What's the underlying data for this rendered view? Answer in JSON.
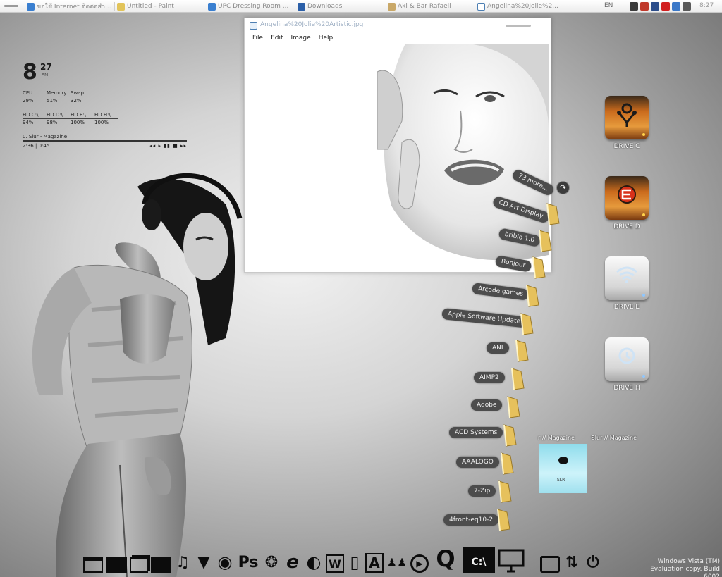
{
  "taskbar": {
    "tasks": [
      {
        "label": "ขอใช้ Internet ติดต่อสำ...",
        "icon": "ie-icon"
      },
      {
        "label": "Untitled - Paint",
        "icon": "paint-icon"
      },
      {
        "label": "UPC Dressing Room ...",
        "icon": "ie-icon"
      },
      {
        "label": "Downloads",
        "icon": "folder-icon"
      },
      {
        "label": "Aki & Bar Rafaeli",
        "icon": "folder-icon"
      },
      {
        "label": "Angelina%20Jolie%2...",
        "icon": "viewer-icon"
      }
    ],
    "language": "EN",
    "time": "8:27"
  },
  "widget": {
    "clock": {
      "hour": "8",
      "minute": "27",
      "ampm": "AM"
    },
    "stats_row1": [
      {
        "key": "CPU",
        "value": "29%"
      },
      {
        "key": "Memory",
        "value": "51%"
      },
      {
        "key": "Swap",
        "value": "32%"
      }
    ],
    "stats_row2": [
      {
        "key": "HD C:\\",
        "value": "94%"
      },
      {
        "key": "HD D:\\",
        "value": "98%"
      },
      {
        "key": "HD E:\\",
        "value": "100%"
      },
      {
        "key": "HD H:\\",
        "value": "100%"
      }
    ],
    "player": {
      "track": "0. Slur - Magazine",
      "elapsed": "2:36",
      "separator": "|",
      "total": "0:45",
      "controls": "◂◂ ▸ ▮▮ ■ ▸▸"
    }
  },
  "viewer": {
    "title": "Angelina%20Jolie%20Artistic.jpg",
    "menu": [
      "File",
      "Edit",
      "Image",
      "Help"
    ]
  },
  "stack": {
    "more_label": "73 more...",
    "items": [
      "CD Art Display",
      "bribIo 1.0",
      "Bonjour",
      "Arcade games",
      "Apple Software Update",
      "ANI",
      "AIMP2",
      "Adobe",
      "ACD Systems",
      "AAALOGO",
      "7-Zip",
      "4front-eq10-2"
    ]
  },
  "drives": [
    {
      "label": "DRIVE C",
      "style": "firewire"
    },
    {
      "label": "DRIVE D",
      "style": "orange-e"
    },
    {
      "label": "DRIVE E",
      "style": "wifi"
    },
    {
      "label": "DRIVE H",
      "style": "timemachine"
    }
  ],
  "album": {
    "label_left": "r // Magazine",
    "label_right": "Slur // Magazine",
    "cover_text": "SLR"
  },
  "dock": {
    "items": [
      {
        "name": "window-icon",
        "glyph": ""
      },
      {
        "name": "windows-tile-icon",
        "glyph": ""
      },
      {
        "name": "stacked-windows-icon",
        "glyph": ""
      },
      {
        "name": "picture-icon",
        "glyph": ""
      },
      {
        "name": "music-note-icon",
        "glyph": "♫"
      },
      {
        "name": "fox-icon",
        "glyph": "▼"
      },
      {
        "name": "cd-icon",
        "glyph": "◉"
      },
      {
        "name": "photoshop-icon",
        "glyph": "Ps"
      },
      {
        "name": "compass-icon",
        "glyph": "❂"
      },
      {
        "name": "internet-explorer-icon",
        "glyph": "e"
      },
      {
        "name": "firefox-icon",
        "glyph": "◐"
      },
      {
        "name": "word-icon",
        "glyph": "W"
      },
      {
        "name": "phone-icon",
        "glyph": "▯"
      },
      {
        "name": "font-icon",
        "glyph": "A"
      },
      {
        "name": "users-icon",
        "glyph": "♟♟"
      },
      {
        "name": "media-player-icon",
        "glyph": "▶"
      },
      {
        "name": "quicktime-icon",
        "glyph": "Q"
      },
      {
        "name": "terminal-icon",
        "glyph": "C:\\"
      },
      {
        "name": "monitor-icon",
        "glyph": ""
      },
      {
        "name": "tv-icon",
        "glyph": ""
      },
      {
        "name": "transfer-icon",
        "glyph": "⇅"
      },
      {
        "name": "power-icon",
        "glyph": "⏻"
      }
    ]
  },
  "watermark": {
    "line1": "Windows Vista (TM)",
    "line2": "Evaluation copy. Build 6002"
  }
}
